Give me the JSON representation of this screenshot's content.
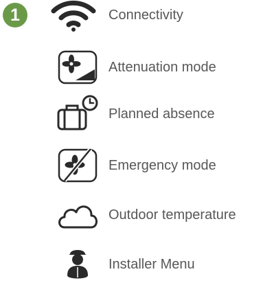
{
  "step_badge": "1",
  "menu": {
    "items": [
      {
        "label": "Connectivity",
        "icon": "wifi-icon"
      },
      {
        "label": "Attenuation mode",
        "icon": "fan-attenuation-icon"
      },
      {
        "label": "Planned absence",
        "icon": "suitcase-clock-icon"
      },
      {
        "label": "Emergency mode",
        "icon": "fan-emergency-icon"
      },
      {
        "label": "Outdoor temperature",
        "icon": "cloud-icon"
      },
      {
        "label": "Installer Menu",
        "icon": "installer-person-icon"
      }
    ]
  },
  "colors": {
    "badge": "#6a9a48",
    "icon": "#4a4a4a",
    "text": "#575757"
  }
}
